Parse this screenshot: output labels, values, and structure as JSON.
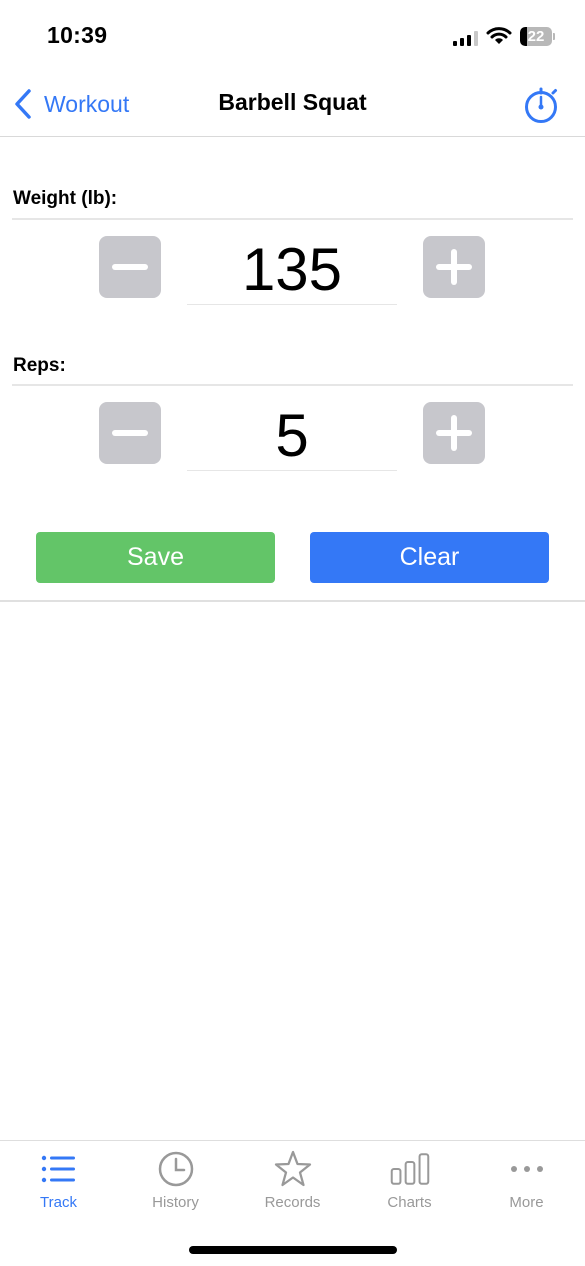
{
  "status_bar": {
    "time": "10:39",
    "battery_percent": "22",
    "battery_level": 0.22,
    "signal_bars_active": 3,
    "signal_bars_total": 4
  },
  "nav": {
    "back_label": "Workout",
    "title": "Barbell Squat",
    "right_icon": "stopwatch-icon"
  },
  "form": {
    "weight": {
      "label": "Weight (lb):",
      "value": "135",
      "decrement_icon": "minus-icon",
      "increment_icon": "plus-icon"
    },
    "reps": {
      "label": "Reps:",
      "value": "5",
      "decrement_icon": "minus-icon",
      "increment_icon": "plus-icon"
    },
    "save_label": "Save",
    "clear_label": "Clear"
  },
  "tabs": [
    {
      "label": "Track",
      "icon": "list-icon",
      "active": true
    },
    {
      "label": "History",
      "icon": "clock-icon",
      "active": false
    },
    {
      "label": "Records",
      "icon": "star-icon",
      "active": false
    },
    {
      "label": "Charts",
      "icon": "bar-chart-icon",
      "active": false
    },
    {
      "label": "More",
      "icon": "more-dots-icon",
      "active": false
    }
  ],
  "colors": {
    "accent": "#3478f6",
    "save": "#63c568",
    "clear": "#3478f6",
    "stepper": "#c7c7cc",
    "inactive_tab": "#999999"
  }
}
